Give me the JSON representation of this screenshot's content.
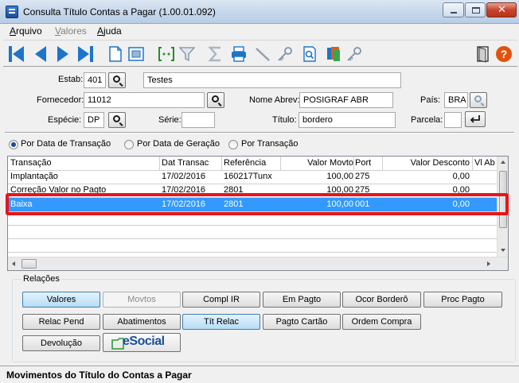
{
  "window": {
    "title": "Consulta Título Contas a Pagar (1.00.01.092)"
  },
  "menu": [
    {
      "pre": "",
      "u": "A",
      "post": "rquivo",
      "disabled": false
    },
    {
      "pre": "",
      "u": "V",
      "post": "alores",
      "disabled": true
    },
    {
      "pre": "",
      "u": "A",
      "post": "juda",
      "disabled": false
    }
  ],
  "form": {
    "estab_label": "Estab:",
    "estab_value": "401",
    "estab_name": "Testes",
    "fornecedor_label": "Fornecedor:",
    "fornecedor_value": "11012",
    "nome_abrev_label": "Nome Abrev:",
    "nome_abrev_value": "POSIGRAF ABR",
    "pais_label": "País:",
    "pais_value": "BRA",
    "especie_label": "Espécie:",
    "especie_value": "DP",
    "serie_label": "Série:",
    "serie_value": "",
    "titulo_label": "Título:",
    "titulo_value": "bordero",
    "parcela_label": "Parcela:",
    "parcela_value": ""
  },
  "sort_options": [
    {
      "label": "Por Data de Transação",
      "selected": true
    },
    {
      "label": "Por Data de Geração",
      "selected": false
    },
    {
      "label": "Por Transação",
      "selected": false
    }
  ],
  "grid": {
    "columns": [
      "Transação",
      "Dat Transac",
      "Referência",
      "Valor Movto",
      "Port",
      "Valor Desconto",
      "Vl Ab"
    ],
    "rows": [
      [
        "Implantação",
        "17/02/2016",
        "160217Tunx",
        "100,00",
        "275",
        "0,00"
      ],
      [
        "Correção Valor no Pagto",
        "17/02/2016",
        "2801",
        "100,00",
        "275",
        "0,00"
      ],
      [
        "Baixa",
        "17/02/2016",
        "2801",
        "100,00",
        "001",
        "0,00"
      ]
    ]
  },
  "relacoes": {
    "label": "Relações",
    "row1": [
      "Valores",
      "Movtos",
      "Compl IR",
      "Em Pagto",
      "Ocor Borderô",
      "Proc Pagto"
    ],
    "row2": [
      "Relac Pend",
      "Abatimentos",
      "Tít Relac",
      "Pagto Cartão",
      "Ordem Compra"
    ],
    "row3": [
      "Devolução"
    ],
    "esocial": "eSocial"
  },
  "status": "Movimentos do Título do Contas a Pagar",
  "colors": {
    "selection": "#3399ff",
    "highlight_border": "#e8141b",
    "toolbar_blue": "#1d75c9"
  }
}
